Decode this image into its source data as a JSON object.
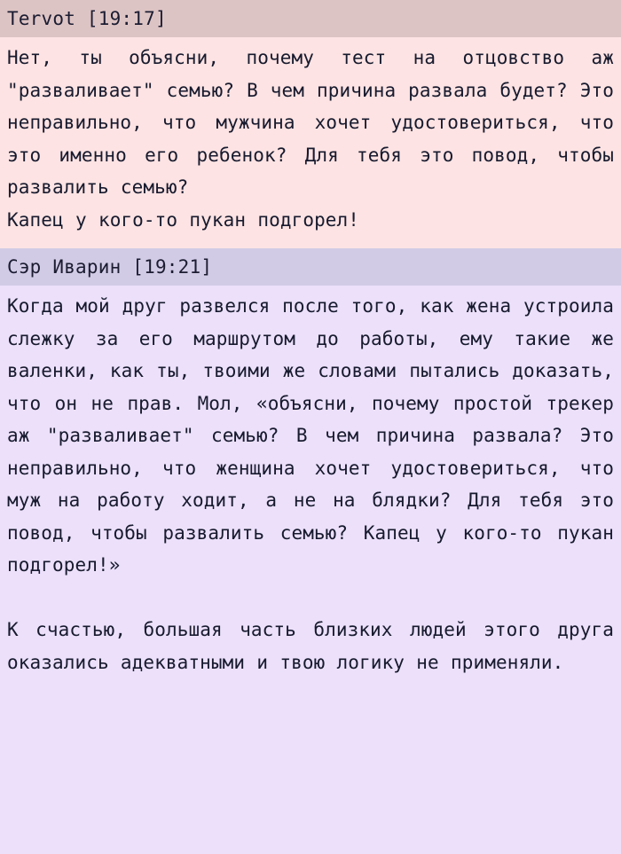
{
  "thread": {
    "posts": [
      {
        "id": "post-1",
        "author": "Tervot",
        "time": "[19:17]",
        "header": "Tervot [19:17]",
        "theme": "pink",
        "header_bg": "#ddc4c4",
        "body_bg": "#fde3e3",
        "text_color": "#171a2e",
        "body": "Нет, ты объясни, почему тест на отцовство аж \"разваливает\" семью? В чем причина развала будет? Это неправильно, что мужчина хочет удостовериться, что это именно его ребенок? Для тебя это повод, чтобы развалить семью?\nКапец у кого-то пукан подгорел!"
      },
      {
        "id": "post-2",
        "author": "Сэр Иварин",
        "time": "[19:21]",
        "header": "Сэр Иварин [19:21]",
        "theme": "lavender",
        "header_bg": "#d2cbe6",
        "body_bg": "#ece0fb",
        "text_color": "#171a2e",
        "body": "Когда мой друг развелся после того, как жена устроила слежку за его маршрутом до работы, ему такие же валенки, как ты, твоими же словами пытались доказать, что он не прав. Мол, «объясни, почему простой трекер аж \"разваливает\" семью? В чем причина развала? Это неправильно, что женщина хочет удостовериться, что муж на работу ходит, а не на блядки? Для тебя это повод, чтобы развалить семью? Капец у кого-то пукан подгорел!»\n\nК счастью, большая часть близких людей этого друга оказались адекватными и твою логику не применяли."
      }
    ]
  }
}
